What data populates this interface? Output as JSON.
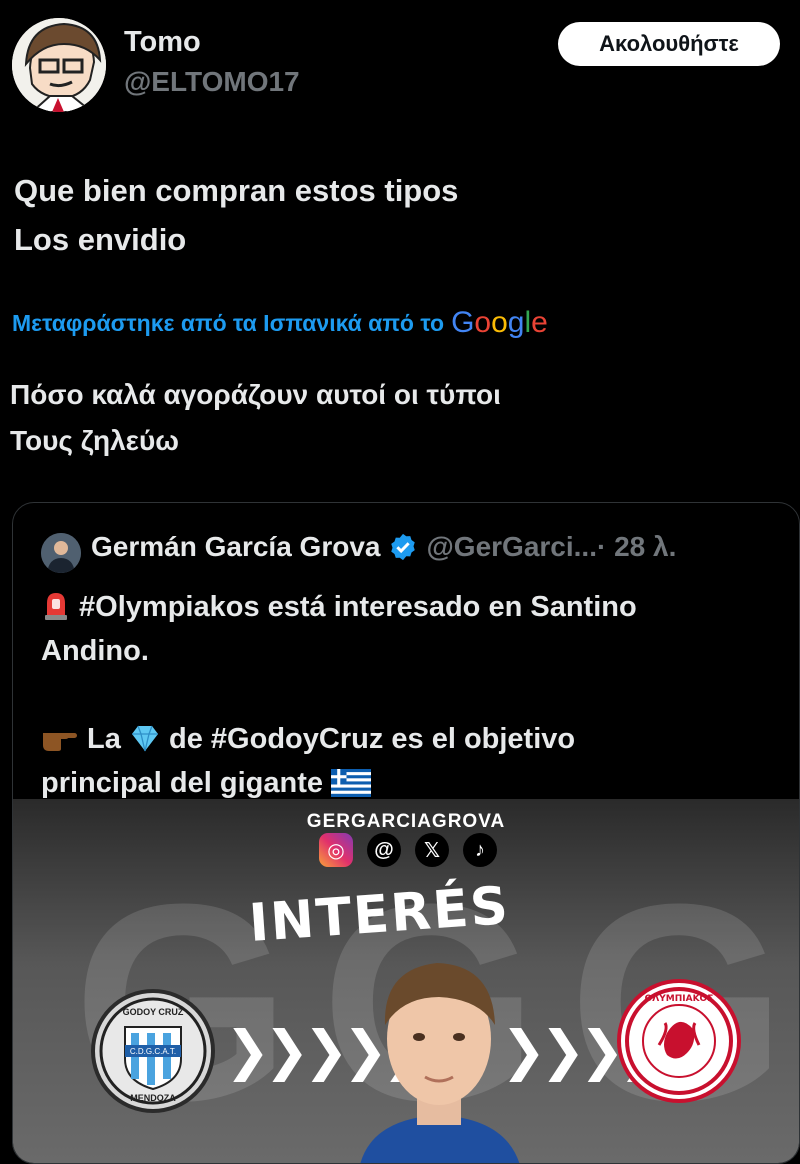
{
  "author": {
    "name": "Tomo",
    "handle": "@ELTOMO17",
    "follow_label": "Ακολουθήστε"
  },
  "tweet": {
    "lines": [
      "Que bien compran estos tipos",
      "Los envidio"
    ],
    "translated_by": "Μεταφράστηκε από τα Ισπανικά από το",
    "translator_brand": "Google",
    "translation_lines": [
      "Πόσο καλά αγοράζουν αυτοί οι τύποι",
      "Τους ζηλεύω"
    ]
  },
  "quote": {
    "name": "Germán García Grova",
    "handle": "@GerGarci...",
    "time": " · 28 λ.",
    "line1a": " #Olympiakos está interesado en Santino",
    "line1b": "Andino.",
    "line2a_1": " La ",
    "line2a_2": " de #GodoyCruz es el objetivo",
    "line2b": "principal del gigante ",
    "media": {
      "brand": "GERGARCIAGROVA",
      "headline": "INTERÉS",
      "background_letters": "GGG",
      "badge_left": "GODOY CRUZ",
      "badge_left_bottom": "MENDOZA",
      "badge_left_center": "C.D.G.C.A.T.",
      "badge_right": "ΟΛΥΜΠΙΑΚΟΣ"
    }
  },
  "colors": {
    "accent": "#1d9bf0",
    "background": "#000000",
    "muted": "#71767b"
  }
}
